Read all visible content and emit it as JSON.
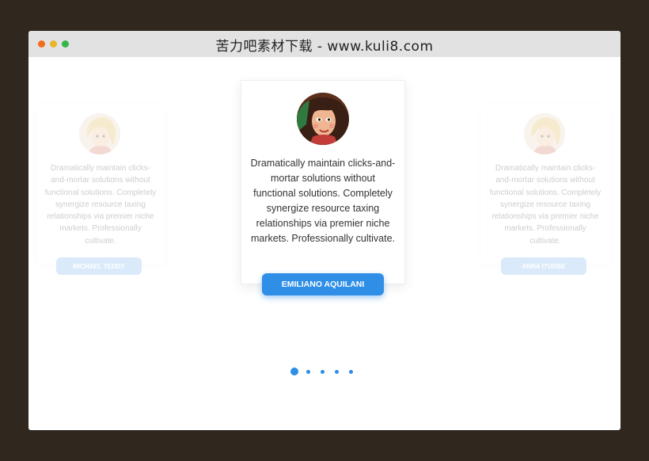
{
  "window": {
    "title": "苦力吧素材下载 - www.kuli8.com"
  },
  "carousel": {
    "active_index": 0,
    "page_count": 5,
    "cards": [
      {
        "position": "left",
        "quote": "Dramatically maintain clicks-and-mortar solutions without functional solutions. Completely synergize resource taxing relationships via premier niche markets. Professionally cultivate.",
        "name": "MICHAEL TEDDY"
      },
      {
        "position": "center",
        "quote": "Dramatically maintain clicks-and-mortar solutions without functional solutions. Completely synergize resource taxing relationships via premier niche markets. Professionally cultivate.",
        "name": "EMILIANO AQUILANI"
      },
      {
        "position": "right",
        "quote": "Dramatically maintain clicks-and-mortar solutions without functional solutions. Completely synergize resource taxing relationships via premier niche markets. Professionally cultivate.",
        "name": "ANNA ITURBE"
      }
    ]
  },
  "colors": {
    "accent": "#2f8ee6",
    "background": "#30271f"
  }
}
